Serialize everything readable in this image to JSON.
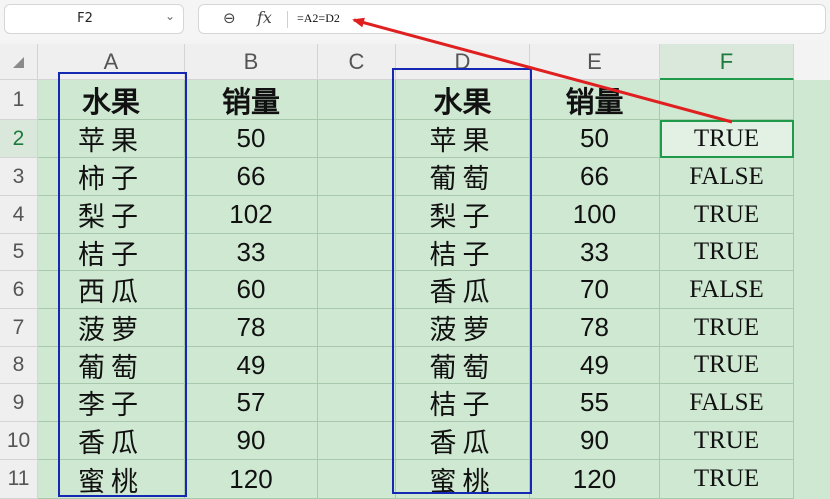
{
  "name_box": {
    "value": "F2"
  },
  "formula_bar": {
    "zoom_icon": "zoom-out-icon",
    "fx_label": "fx",
    "formula": "=A2=D2"
  },
  "columns": [
    "A",
    "B",
    "C",
    "D",
    "E",
    "F"
  ],
  "rows": [
    "1",
    "2",
    "3",
    "4",
    "5",
    "6",
    "7",
    "8",
    "9",
    "10",
    "11"
  ],
  "active_cell": {
    "column": "F",
    "row": "2"
  },
  "headers": {
    "a": "水果",
    "b": "销量",
    "d": "水果",
    "e": "销量"
  },
  "table_left": [
    {
      "fruit": "苹果",
      "sales": "50"
    },
    {
      "fruit": "柿子",
      "sales": "66"
    },
    {
      "fruit": "梨子",
      "sales": "102"
    },
    {
      "fruit": "桔子",
      "sales": "33"
    },
    {
      "fruit": "西瓜",
      "sales": "60"
    },
    {
      "fruit": "菠萝",
      "sales": "78"
    },
    {
      "fruit": "葡萄",
      "sales": "49"
    },
    {
      "fruit": "李子",
      "sales": "57"
    },
    {
      "fruit": "香瓜",
      "sales": "90"
    },
    {
      "fruit": "蜜桃",
      "sales": "120"
    }
  ],
  "table_right": [
    {
      "fruit": "苹果",
      "sales": "50",
      "result": "TRUE"
    },
    {
      "fruit": "葡萄",
      "sales": "66",
      "result": "FALSE"
    },
    {
      "fruit": "梨子",
      "sales": "100",
      "result": "TRUE"
    },
    {
      "fruit": "桔子",
      "sales": "33",
      "result": "TRUE"
    },
    {
      "fruit": "香瓜",
      "sales": "70",
      "result": "FALSE"
    },
    {
      "fruit": "菠萝",
      "sales": "78",
      "result": "TRUE"
    },
    {
      "fruit": "葡萄",
      "sales": "49",
      "result": "TRUE"
    },
    {
      "fruit": "桔子",
      "sales": "55",
      "result": "FALSE"
    },
    {
      "fruit": "香瓜",
      "sales": "90",
      "result": "TRUE"
    },
    {
      "fruit": "蜜桃",
      "sales": "120",
      "result": "TRUE"
    }
  ],
  "colors": {
    "cell_fill": "#cfe8d2",
    "highlight_box": "#1428b4",
    "annotation_arrow": "#e02020",
    "active_accent": "#1f9a4a"
  }
}
